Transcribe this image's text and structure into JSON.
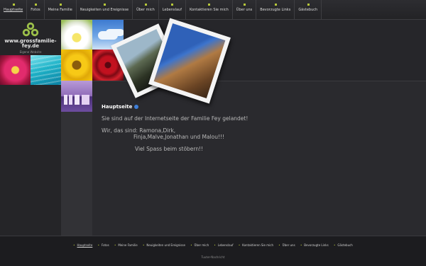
{
  "nav": {
    "items": [
      {
        "label": "Hauptseite",
        "active": true
      },
      {
        "label": "Fotos"
      },
      {
        "label": "Meine Familie"
      },
      {
        "label": "Neuigkeiten und Ereignisse"
      },
      {
        "label": "Über mich"
      },
      {
        "label": "Lebenslauf"
      },
      {
        "label": "Kontaktieren Sie mich"
      },
      {
        "label": "Über uns"
      },
      {
        "label": "Bevorzugte Links"
      },
      {
        "label": "Gästebuch"
      }
    ]
  },
  "logo": {
    "site": "www.grossfamilie-fey.de",
    "tagline": "Eigene Website",
    "icon": "trefoil-logo"
  },
  "main": {
    "title": "Hauptseite",
    "title_icon": "info-icon",
    "line1": "Sie sind auf der Internetseite der Familie Fey gelandet!",
    "line2": "Wir, das sind: Ramona,Dirk,",
    "line3": "Finja,Malve,Jonathan und Malou!!!",
    "line4": "Viel Spass beim stöbern!!"
  },
  "footer": {
    "items": [
      {
        "label": "Hauptseite",
        "active": true
      },
      {
        "label": "Fotos"
      },
      {
        "label": "Meine Familie"
      },
      {
        "label": "Neuigkeiten und Ereignisse"
      },
      {
        "label": "Über mich"
      },
      {
        "label": "Lebenslauf"
      },
      {
        "label": "Kontaktieren Sie mich"
      },
      {
        "label": "Über uns"
      },
      {
        "label": "Bevorzugte Links"
      },
      {
        "label": "Gästebuch"
      }
    ],
    "impressum": "Tuuter-Nachricht"
  },
  "colors": {
    "accent": "#b7c83a",
    "background": "#26262a",
    "info": "#3f7fd8"
  }
}
